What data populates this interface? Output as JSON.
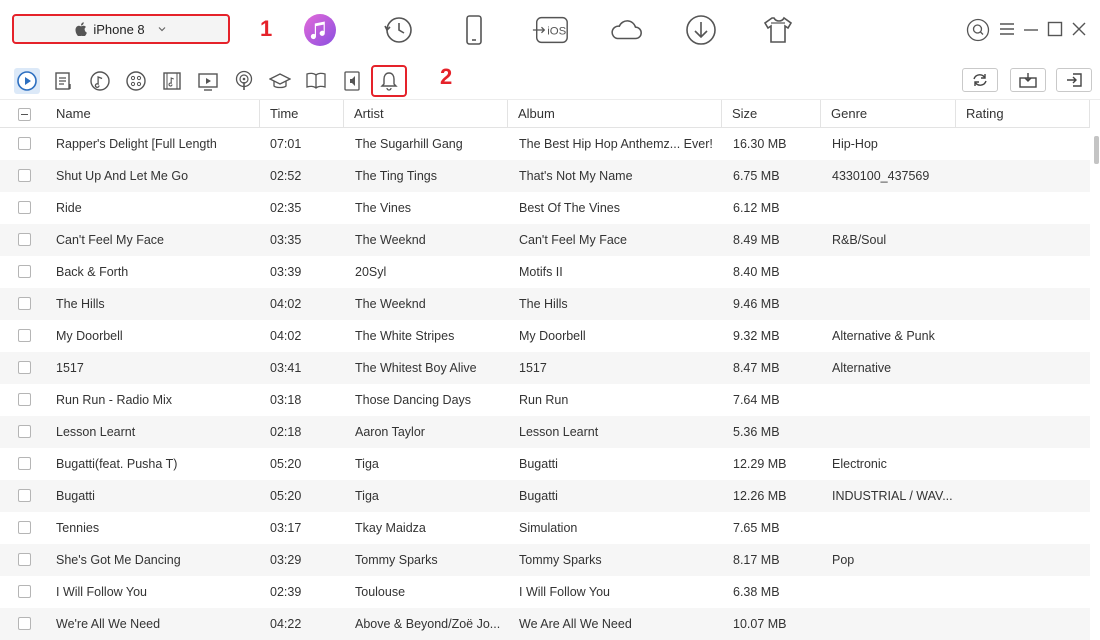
{
  "device": {
    "name": "iPhone 8"
  },
  "annotations": {
    "one": "1",
    "two": "2"
  },
  "top_modes": [
    {
      "icon": "itunes-music-icon"
    },
    {
      "icon": "history-clock-icon"
    },
    {
      "icon": "phone-device-icon"
    },
    {
      "icon": "ios-mover-icon",
      "label": "iOS"
    },
    {
      "icon": "icloud-icon"
    },
    {
      "icon": "download-icon"
    },
    {
      "icon": "tshirt-icon"
    }
  ],
  "categories": [
    {
      "icon": "music-play-icon",
      "active": true
    },
    {
      "icon": "playlist-icon"
    },
    {
      "icon": "music-note-icon"
    },
    {
      "icon": "voice-memo-icon"
    },
    {
      "icon": "music-video-icon"
    },
    {
      "icon": "movie-icon"
    },
    {
      "icon": "podcast-icon"
    },
    {
      "icon": "itunes-u-icon"
    },
    {
      "icon": "book-icon"
    },
    {
      "icon": "audiobook-icon"
    },
    {
      "icon": "ringtone-bell-icon",
      "highlighted": true
    }
  ],
  "actions": [
    {
      "icon": "refresh-icon"
    },
    {
      "icon": "add-to-device-icon"
    },
    {
      "icon": "export-to-computer-icon"
    }
  ],
  "table": {
    "columns": [
      "Name",
      "Time",
      "Artist",
      "Album",
      "Size",
      "Genre",
      "Rating"
    ],
    "rows": [
      [
        "Rapper's Delight [Full Length",
        "07:01",
        "The Sugarhill Gang",
        "The Best Hip Hop Anthemz... Ever!",
        "16.30 MB",
        "Hip-Hop",
        ""
      ],
      [
        "Shut Up And Let Me Go",
        "02:52",
        "The Ting Tings",
        "That's Not My Name",
        "6.75 MB",
        "4330100_437569",
        ""
      ],
      [
        "Ride",
        "02:35",
        "The Vines",
        "Best Of The Vines",
        "6.12 MB",
        "",
        ""
      ],
      [
        "Can't Feel My Face",
        "03:35",
        "The Weeknd",
        "Can't Feel My Face",
        "8.49 MB",
        "R&B/Soul",
        ""
      ],
      [
        "Back & Forth",
        "03:39",
        "20Syl",
        "Motifs II",
        "8.40 MB",
        "",
        ""
      ],
      [
        "The Hills",
        "04:02",
        "The Weeknd",
        "The Hills",
        "9.46 MB",
        "",
        ""
      ],
      [
        "My Doorbell",
        "04:02",
        "The White Stripes",
        "My Doorbell",
        "9.32 MB",
        "Alternative & Punk",
        ""
      ],
      [
        "1517",
        "03:41",
        "The Whitest Boy Alive",
        "1517",
        "8.47 MB",
        "Alternative",
        ""
      ],
      [
        "Run Run - Radio Mix",
        "03:18",
        "Those Dancing Days",
        "Run Run",
        "7.64 MB",
        "",
        ""
      ],
      [
        "Lesson Learnt",
        "02:18",
        "Aaron Taylor",
        "Lesson Learnt",
        "5.36 MB",
        "",
        ""
      ],
      [
        "Bugatti(feat. Pusha T)",
        "05:20",
        "Tiga",
        "Bugatti",
        "12.29 MB",
        "Electronic",
        ""
      ],
      [
        "Bugatti",
        "05:20",
        "Tiga",
        "Bugatti",
        "12.26 MB",
        "INDUSTRIAL / WAV...",
        ""
      ],
      [
        "Tennies",
        "03:17",
        "Tkay Maidza",
        "Simulation",
        "7.65 MB",
        "",
        ""
      ],
      [
        "She's Got Me Dancing",
        "03:29",
        "Tommy Sparks",
        "Tommy Sparks",
        "8.17 MB",
        "Pop",
        ""
      ],
      [
        "I Will Follow You",
        "02:39",
        "Toulouse",
        "I Will Follow You",
        "6.38 MB",
        "",
        ""
      ],
      [
        "We're All We Need",
        "04:22",
        "Above & Beyond/Zoë Jo...",
        "We Are All We Need",
        "10.07 MB",
        "",
        ""
      ]
    ]
  },
  "colors": {
    "accent": "#e5222a",
    "active_bg": "#dce9f8",
    "itunes_purple": "#b05ad8"
  }
}
